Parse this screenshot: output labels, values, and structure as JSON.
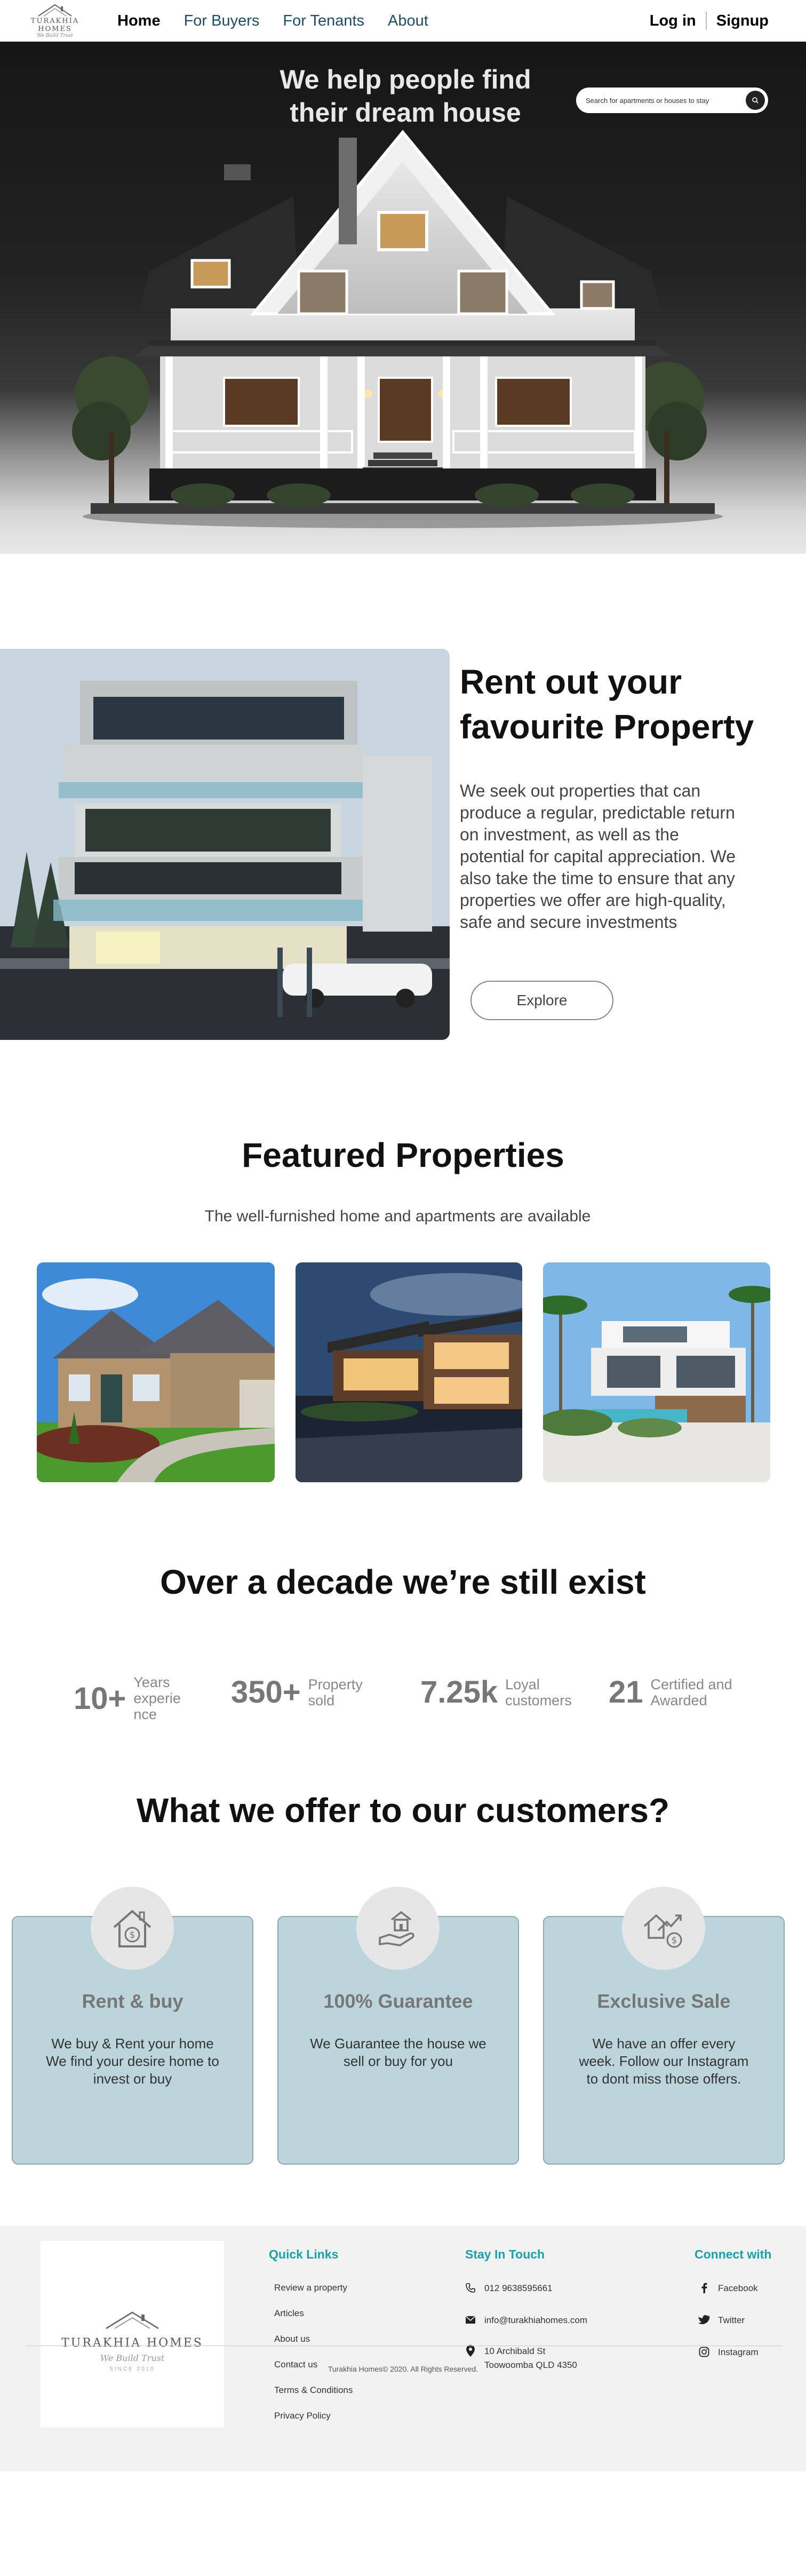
{
  "nav": {
    "logo": {
      "name": "TURAKHIA HOMES",
      "tagline": "We Build Trust"
    },
    "links": [
      {
        "label": "Home"
      },
      {
        "label": "For Buyers"
      },
      {
        "label": "For Tenants"
      },
      {
        "label": "About"
      }
    ],
    "login": "Log in",
    "signup": "Signup"
  },
  "hero": {
    "title_line1": "We help people find",
    "title_line2": "their dream house",
    "search_placeholder": "Search for apartments or houses to stay"
  },
  "rent": {
    "title_line1": "Rent out your",
    "title_line2": "favourite Property",
    "text": "We seek out properties that can produce a regular, predictable return on investment, as well as the potential for capital appreciation. We also take the time to ensure that any properties we offer are high-quality, safe and secure investments",
    "button": "Explore"
  },
  "featured": {
    "title": "Featured Properties",
    "subtitle": "The well-furnished home and apartments are available"
  },
  "stats": {
    "title": "Over a decade we’re still exist",
    "items": [
      {
        "number": "10+",
        "label_line1": "Years",
        "label_line2": "experie",
        "label_line3": "nce"
      },
      {
        "number": "350+",
        "label_line1": "Property",
        "label_line2": "sold"
      },
      {
        "number": "7.25k",
        "label_line1": "Loyal",
        "label_line2": "customers"
      },
      {
        "number": "21",
        "label_line1": "Certified and",
        "label_line2": "Awarded"
      }
    ]
  },
  "offers": {
    "title": "What we offer to our customers?",
    "cards": [
      {
        "icon": "house-dollar-icon",
        "title": "Rent & buy",
        "text": "We buy & Rent your home We find your desire home to invest or buy"
      },
      {
        "icon": "hand-house-icon",
        "title": "100% Guarantee",
        "text": "We Guarantee the house we sell or buy for you"
      },
      {
        "icon": "house-growth-icon",
        "title": "Exclusive Sale",
        "text": "We have an offer every week. Follow our Instagram to dont miss those offers."
      }
    ]
  },
  "footer": {
    "logo": {
      "name": "TURAKHIA HOMES",
      "tagline": "We Build Trust",
      "est": "SINCE 2010"
    },
    "quick_links_title": "Quick Links",
    "quick_links": [
      "Review a property",
      "Articles",
      "About us",
      "Contact us",
      "Terms & Conditions",
      "Privacy Policy"
    ],
    "touch_title": "Stay In Touch",
    "phone": "012 9638595661",
    "email": "info@turakhiahomes.com",
    "address_line1": "10 Archibald St",
    "address_line2": "Toowoomba QLD 4350",
    "connect_title": "Connect with",
    "social": [
      "Facebook",
      "Twitter",
      "Instagram"
    ],
    "copyright": "Turakhia Homes© 2020. All Rights Reserved."
  }
}
